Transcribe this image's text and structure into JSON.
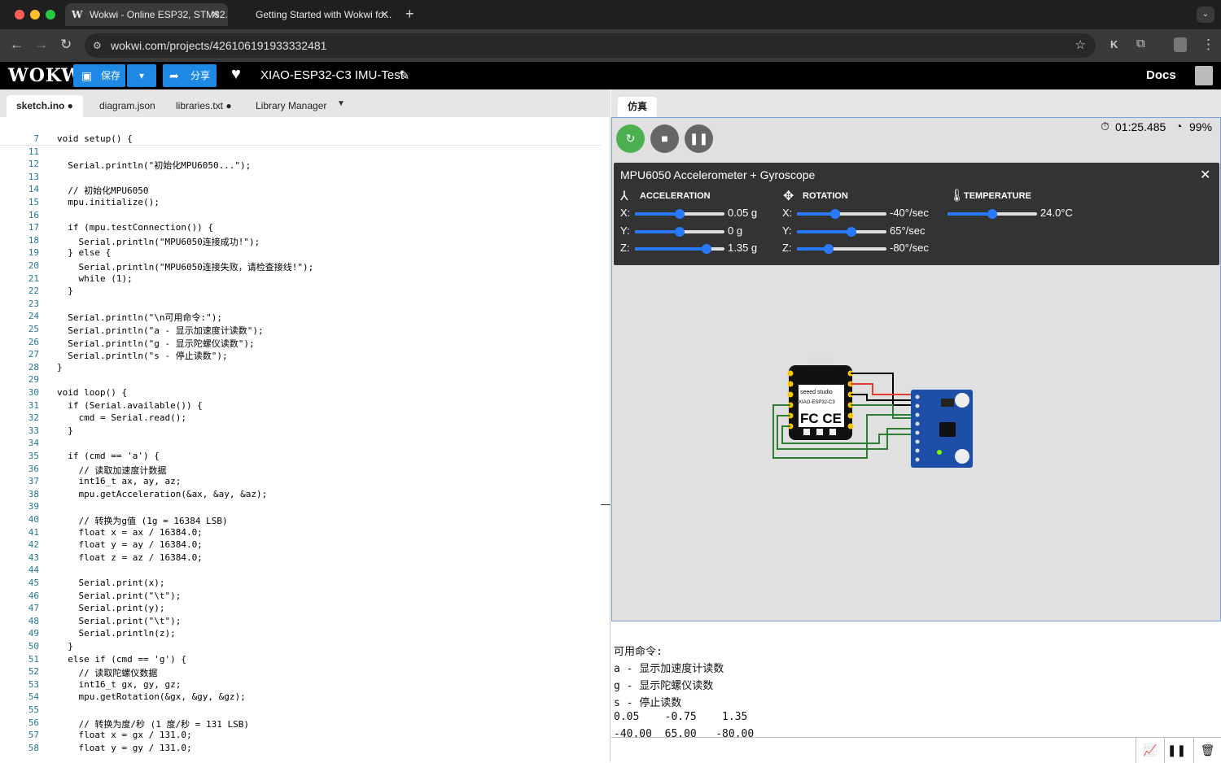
{
  "browser": {
    "tabs": [
      {
        "title": "Wokwi - Online ESP32, STM32...",
        "active": true
      },
      {
        "title": "Getting Started with Wokwi fo...",
        "active": false
      }
    ],
    "url": "wokwi.com/projects/426106191933332481"
  },
  "app": {
    "logo": "WOKWi",
    "save_label": "保存",
    "share_label": "分享",
    "project_name": "XIAO-ESP32-C3 IMU-Test",
    "docs_label": "Docs"
  },
  "editor": {
    "tabs": [
      {
        "label": "sketch.ino ●",
        "active": true
      },
      {
        "label": "diagram.json",
        "active": false
      },
      {
        "label": "libraries.txt ●",
        "active": false
      },
      {
        "label": "Library Manager",
        "active": false
      }
    ],
    "lines": [
      {
        "n": "7",
        "code": "void setup() {"
      },
      {
        "n": "11",
        "code": ""
      },
      {
        "n": "12",
        "code": "  Serial.println(\"初始化MPU6050...\");"
      },
      {
        "n": "13",
        "code": ""
      },
      {
        "n": "14",
        "code": "  // 初始化MPU6050"
      },
      {
        "n": "15",
        "code": "  mpu.initialize();"
      },
      {
        "n": "16",
        "code": ""
      },
      {
        "n": "17",
        "code": "  if (mpu.testConnection()) {"
      },
      {
        "n": "18",
        "code": "    Serial.println(\"MPU6050连接成功!\");"
      },
      {
        "n": "19",
        "code": "  } else {"
      },
      {
        "n": "20",
        "code": "    Serial.println(\"MPU6050连接失败，请检查接线!\");"
      },
      {
        "n": "21",
        "code": "    while (1);"
      },
      {
        "n": "22",
        "code": "  }"
      },
      {
        "n": "23",
        "code": ""
      },
      {
        "n": "24",
        "code": "  Serial.println(\"\\n可用命令:\");"
      },
      {
        "n": "25",
        "code": "  Serial.println(\"a - 显示加速度计读数\");"
      },
      {
        "n": "26",
        "code": "  Serial.println(\"g - 显示陀螺仪读数\");"
      },
      {
        "n": "27",
        "code": "  Serial.println(\"s - 停止读数\");"
      },
      {
        "n": "28",
        "code": "}"
      },
      {
        "n": "29",
        "code": ""
      },
      {
        "n": "30",
        "code": "void loop() {"
      },
      {
        "n": "31",
        "code": "  if (Serial.available()) {"
      },
      {
        "n": "32",
        "code": "    cmd = Serial.read();"
      },
      {
        "n": "33",
        "code": "  }"
      },
      {
        "n": "34",
        "code": ""
      },
      {
        "n": "35",
        "code": "  if (cmd == 'a') {"
      },
      {
        "n": "36",
        "code": "    // 读取加速度计数据"
      },
      {
        "n": "37",
        "code": "    int16_t ax, ay, az;"
      },
      {
        "n": "38",
        "code": "    mpu.getAcceleration(&ax, &ay, &az);"
      },
      {
        "n": "39",
        "code": ""
      },
      {
        "n": "40",
        "code": "    // 转换为g值 (1g = 16384 LSB)"
      },
      {
        "n": "41",
        "code": "    float x = ax / 16384.0;"
      },
      {
        "n": "42",
        "code": "    float y = ay / 16384.0;"
      },
      {
        "n": "43",
        "code": "    float z = az / 16384.0;"
      },
      {
        "n": "44",
        "code": ""
      },
      {
        "n": "45",
        "code": "    Serial.print(x);"
      },
      {
        "n": "46",
        "code": "    Serial.print(\"\\t\");"
      },
      {
        "n": "47",
        "code": "    Serial.print(y);"
      },
      {
        "n": "48",
        "code": "    Serial.print(\"\\t\");"
      },
      {
        "n": "49",
        "code": "    Serial.println(z);"
      },
      {
        "n": "50",
        "code": "  }"
      },
      {
        "n": "51",
        "code": "  else if (cmd == 'g') {"
      },
      {
        "n": "52",
        "code": "    // 读取陀螺仪数据"
      },
      {
        "n": "53",
        "code": "    int16_t gx, gy, gz;"
      },
      {
        "n": "54",
        "code": "    mpu.getRotation(&gx, &gy, &gz);"
      },
      {
        "n": "55",
        "code": ""
      },
      {
        "n": "56",
        "code": "    // 转换为度/秒 (1 度/秒 = 131 LSB)"
      },
      {
        "n": "57",
        "code": "    float x = gx / 131.0;"
      },
      {
        "n": "58",
        "code": "    float y = gy / 131.0;"
      }
    ]
  },
  "simulation": {
    "tab_label": "仿真",
    "timer": "01:25.485",
    "speed": "99%",
    "panel": {
      "title": "MPU6050 Accelerometer + Gyroscope",
      "acceleration": {
        "label": "ACCELERATION",
        "axes": [
          {
            "axis": "X:",
            "value": "0.05 g",
            "level": 0.5
          },
          {
            "axis": "Y:",
            "value": "0 g",
            "level": 0.5
          },
          {
            "axis": "Z:",
            "value": "1.35 g",
            "level": 0.8
          }
        ]
      },
      "rotation": {
        "label": "ROTATION",
        "axes": [
          {
            "axis": "X:",
            "value": "-40°/sec",
            "level": 0.43
          },
          {
            "axis": "Y:",
            "value": "65°/sec",
            "level": 0.61
          },
          {
            "axis": "Z:",
            "value": "-80°/sec",
            "level": 0.35
          }
        ]
      },
      "temperature": {
        "label": "TEMPERATURE",
        "value": "24.0°C",
        "level": 0.5
      }
    },
    "board_text": {
      "brand": "seeed studio",
      "model": "XIAO-ESP32-C3",
      "marks": "FC CE"
    }
  },
  "serial": {
    "lines": [
      "可用命令:",
      "a - 显示加速度计读数",
      "g - 显示陀螺仪读数",
      "s - 停止读数",
      "0.05    -0.75    1.35",
      "-40.00  65.00   -80.00"
    ]
  }
}
